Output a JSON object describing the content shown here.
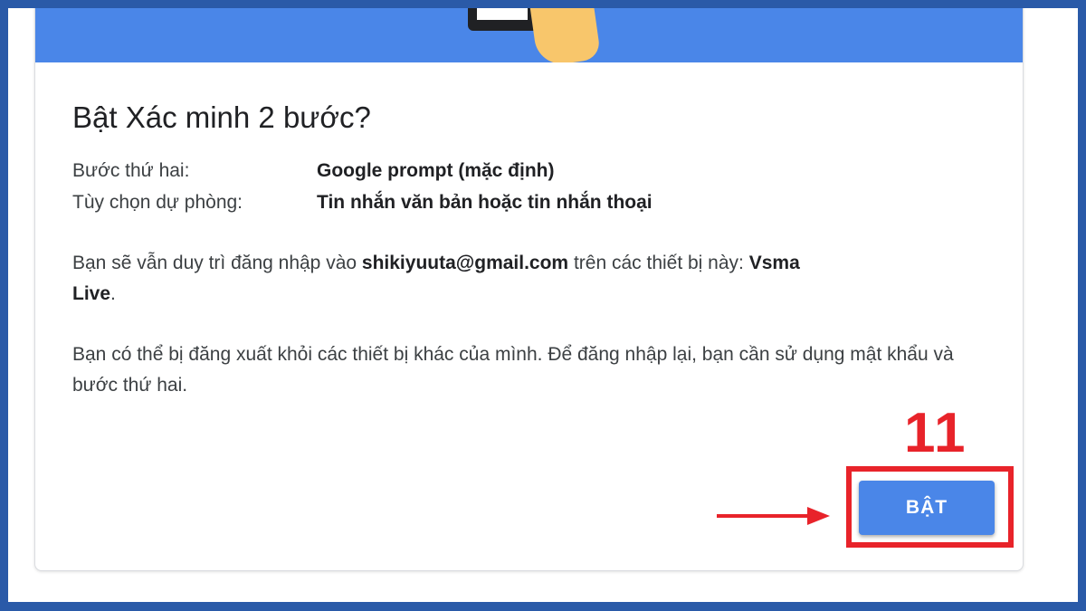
{
  "dialog": {
    "title": "Bật Xác minh 2 bước?",
    "rows": [
      {
        "label": "Bước thứ hai:",
        "value": "Google prompt (mặc định)"
      },
      {
        "label": "Tùy chọn dự phòng:",
        "value": "Tin nhắn văn bản hoặc tin nhắn thoại"
      }
    ],
    "paragraph1": {
      "part1": "Bạn sẽ vẫn duy trì đăng nhập vào ",
      "email": "shikiyuuta@gmail.com",
      "part2": " trên các thiết bị này: ",
      "device": "Vsma",
      "device2": "Live",
      "end": "."
    },
    "paragraph2": "Bạn có thể bị đăng xuất khỏi các thiết bị khác của mình. Để đăng nhập lại, bạn cần sử dụng mật khẩu và bước thứ hai.",
    "button_label": "BẬT"
  },
  "annotation": {
    "step_number": "11",
    "color": "#e8232a"
  },
  "colors": {
    "banner": "#4a86e8",
    "button": "#4a86e8",
    "frame": "#2a5aa8"
  }
}
